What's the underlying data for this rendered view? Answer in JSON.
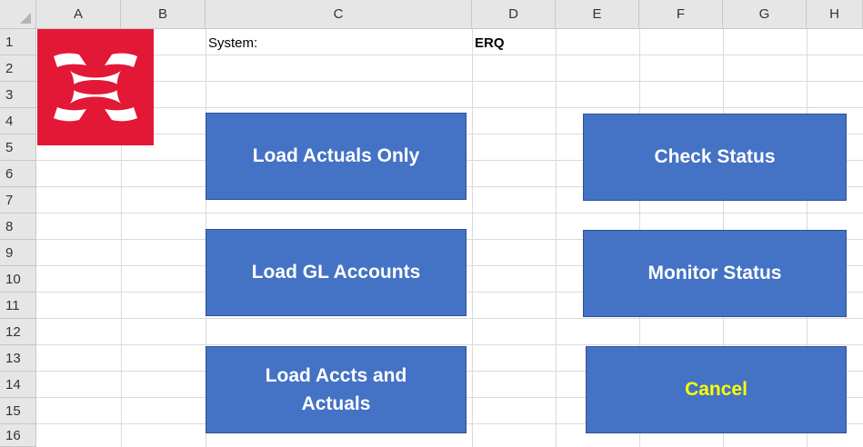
{
  "columns": [
    "A",
    "B",
    "C",
    "D",
    "E",
    "F",
    "G",
    "H"
  ],
  "rows": [
    "1",
    "2",
    "3",
    "4",
    "5",
    "6",
    "7",
    "8",
    "9",
    "10",
    "11",
    "12",
    "13",
    "14",
    "15",
    "16"
  ],
  "cells": {
    "c1": "System:",
    "d1": "ERQ"
  },
  "logo": {
    "icon": "under-armour-logo",
    "background_color": "#e31837"
  },
  "buttons": {
    "load_actuals_only": "Load Actuals Only",
    "load_gl_accounts": "Load GL Accounts",
    "load_accts_and_actuals_line1": "Load Accts and",
    "load_accts_and_actuals_line2": "Actuals",
    "check_status": "Check Status",
    "monitor_status": "Monitor Status",
    "cancel": "Cancel"
  },
  "colors": {
    "button_fill": "#4472c4",
    "button_text": "#ffffff",
    "cancel_text": "#ffff00"
  }
}
